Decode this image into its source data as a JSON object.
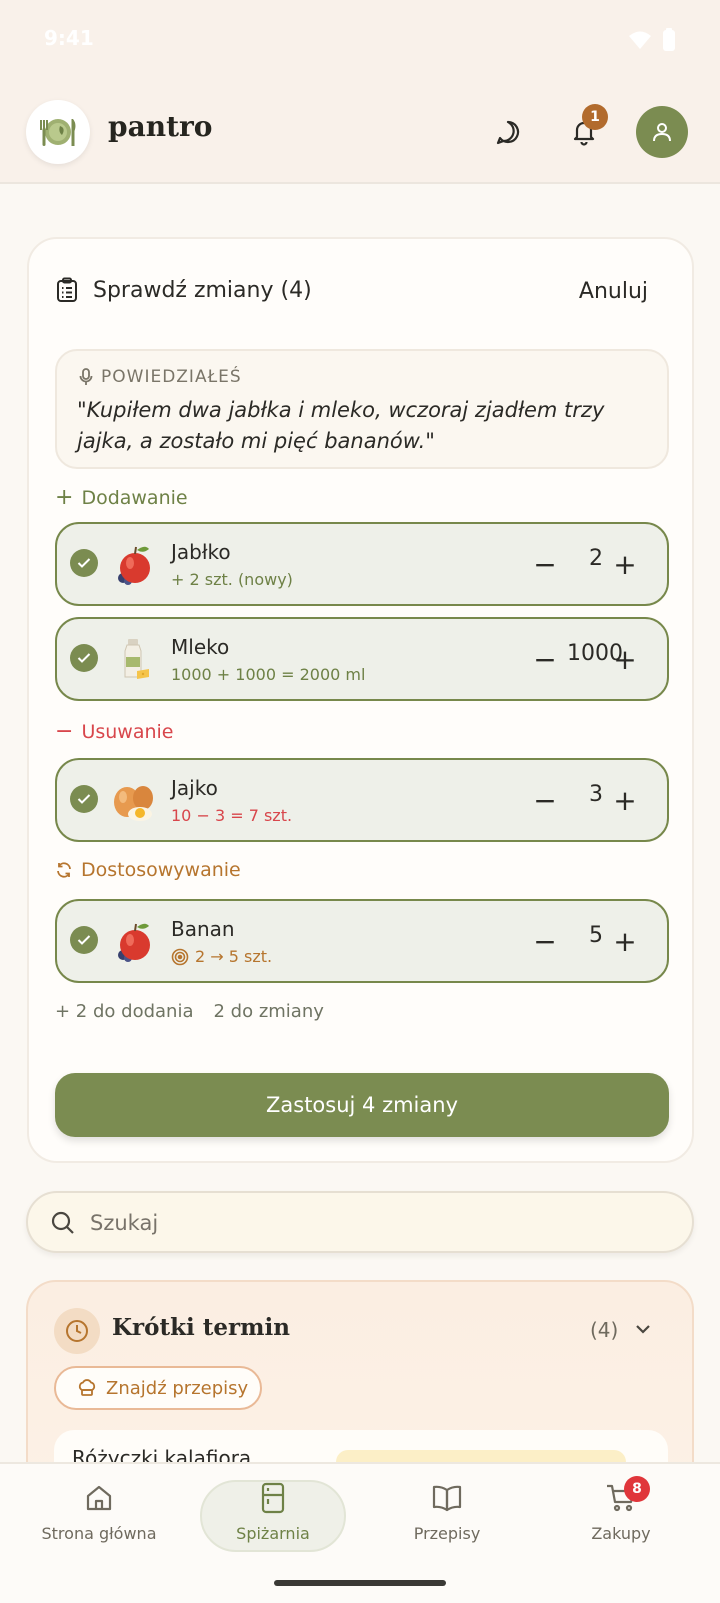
{
  "status": {
    "time": "9:41"
  },
  "header": {
    "brand": "pantro",
    "notifications_count": "1"
  },
  "review": {
    "title": "Sprawdź zmiany (4)",
    "cancel": "Anuluj",
    "quote_label": "POWIEDZIAŁEŚ",
    "quote": "\"Kupiłem dwa jabłka i mleko, wczoraj zjadłem trzy jajka, a zostało mi pięć bananów.\"",
    "sections": {
      "add": "Dodawanie",
      "remove": "Usuwanie",
      "adjust": "Dostosowywanie"
    },
    "items": [
      {
        "name": "Jabłko",
        "detail": "+ 2 szt. (nowy)",
        "qty": "2",
        "icon": "apple-icon"
      },
      {
        "name": "Mleko",
        "detail": "1000 + 1000 = 2000 ml",
        "qty": "1000",
        "icon": "milk-icon"
      },
      {
        "name": "Jajko",
        "detail": "10 − 3 = 7 szt.",
        "qty": "3",
        "icon": "egg-icon"
      },
      {
        "name": "Banan",
        "detail": "2 → 5 szt.",
        "qty": "5",
        "icon": "apple-icon"
      }
    ],
    "summary": {
      "to_add": "+ 2 do dodania",
      "to_change": "2 do zmiany"
    },
    "apply": "Zastosuj 4 zmiany"
  },
  "search": {
    "placeholder": "Szukaj"
  },
  "short_term": {
    "title": "Krótki termin",
    "count": "(4)",
    "find_recipes": "Znajdź przepisy",
    "first_item": "Różyczki kalafiora"
  },
  "nav": {
    "items": [
      {
        "label": "Strona główna",
        "icon": "home-icon"
      },
      {
        "label": "Spiżarnia",
        "icon": "fridge-icon"
      },
      {
        "label": "Przepisy",
        "icon": "book-icon"
      },
      {
        "label": "Zakupy",
        "icon": "cart-icon"
      }
    ],
    "cart_count": "8"
  },
  "colors": {
    "accent": "#7b8c51",
    "remove": "#d8464b",
    "adjust": "#b6752e",
    "badge": "#b26b2d"
  }
}
